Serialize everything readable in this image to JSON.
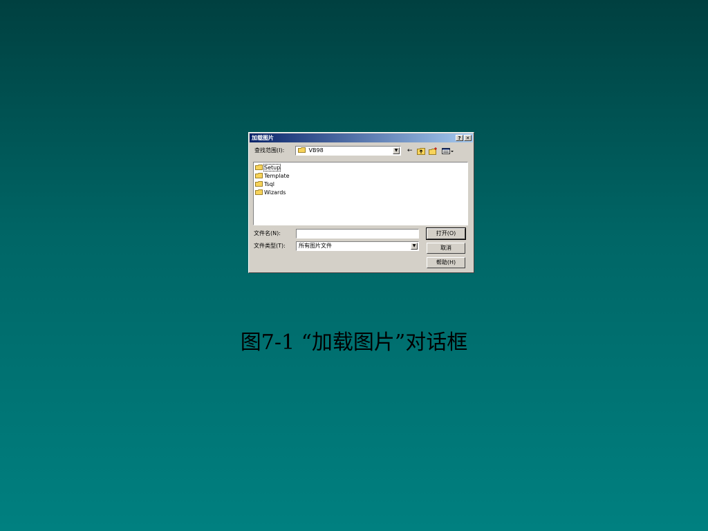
{
  "dialog": {
    "title": "加载图片",
    "help_button": "?",
    "close_button": "✕",
    "look_in_label": "查找范围(I):",
    "look_in_value": "VB98",
    "files": [
      "Setup",
      "Template",
      "Tsql",
      "Wizards"
    ],
    "filename_label": "文件名(N):",
    "filename_value": "",
    "filetype_label": "文件类型(T):",
    "filetype_value": "所有图片文件",
    "open_button": "打开(O)",
    "cancel_button": "取消",
    "help_button_label": "帮助(H)"
  },
  "caption": "图7-1 “加载图片”对话框",
  "colors": {
    "titlebar_start": "#0a246a",
    "dialog_bg": "#d4d0c8",
    "folder_yellow": "#f7d35a"
  }
}
